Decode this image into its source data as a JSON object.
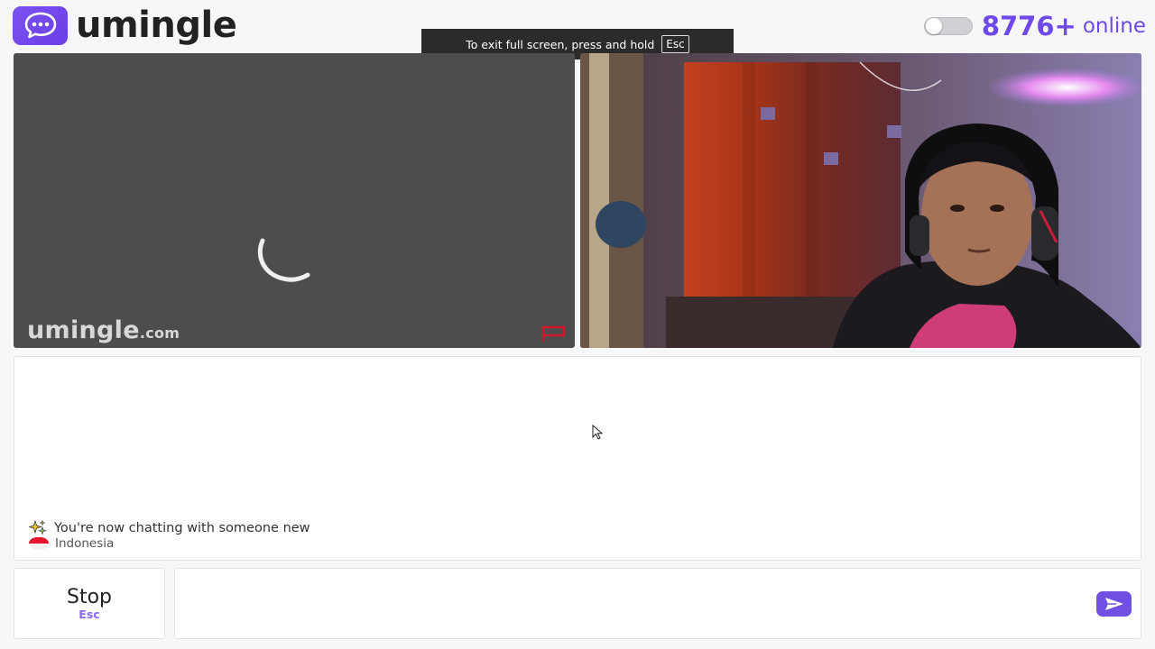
{
  "header": {
    "logo_text": "umingle",
    "online_count": "8776+",
    "online_label": "online",
    "toggle_state": "off",
    "accent_color": "#6e48e8"
  },
  "fullscreen_notice": {
    "text": "To exit full screen, press and hold",
    "key": "Esc"
  },
  "video": {
    "left": {
      "watermark": "umingle",
      "watermark_suffix": ".com",
      "state": "loading"
    },
    "right": {
      "state": "stranger-video"
    }
  },
  "chat": {
    "status_message": "You're now chatting with someone new",
    "country": "Indonesia"
  },
  "controls": {
    "stop_label": "Stop",
    "stop_key": "Esc",
    "message_placeholder": "",
    "send_icon": "send-icon"
  }
}
